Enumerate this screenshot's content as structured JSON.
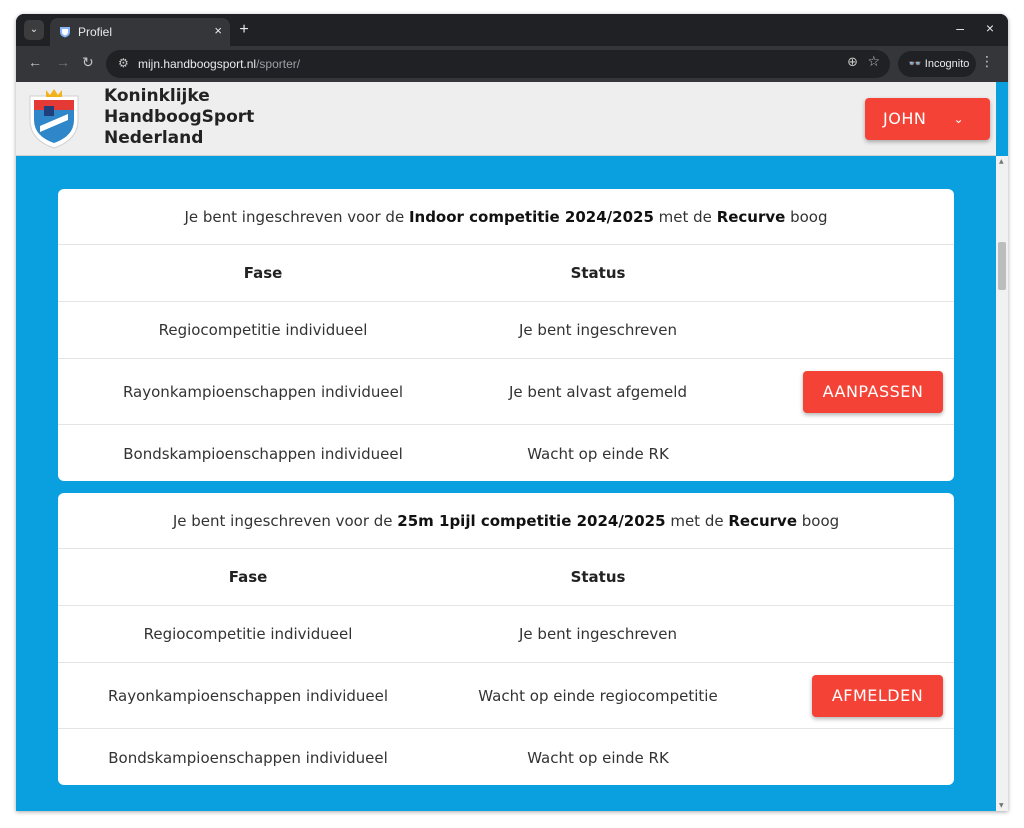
{
  "browser": {
    "tab_title": "Profiel",
    "tab_close": "×",
    "new_tab": "+",
    "url_host": "mijn.handboogsport.nl",
    "url_path": "/sporter/",
    "incognito_label": "Incognito",
    "min": "–",
    "close": "×"
  },
  "header": {
    "org_line1": "Koninklijke",
    "org_line2": "HandboogSport",
    "org_line3": "Nederland",
    "user_button": "JOHN"
  },
  "cards": [
    {
      "intro_prefix": "Je bent ingeschreven voor de ",
      "competition": "Indoor competitie 2024/2025",
      "intro_mid": " met de ",
      "bow": "Recurve",
      "intro_suffix": " boog",
      "col_phase": "Fase",
      "col_status": "Status",
      "rows": [
        {
          "phase": "Regiocompetitie individueel",
          "status": "Je bent ingeschreven"
        },
        {
          "phase": "Rayonkampioenschappen individueel",
          "status": "Je bent alvast afgemeld",
          "action": "AANPASSEN"
        },
        {
          "phase": "Bondskampioenschappen individueel",
          "status": "Wacht op einde RK"
        }
      ]
    },
    {
      "intro_prefix": "Je bent ingeschreven voor de ",
      "competition": "25m 1pijl competitie 2024/2025",
      "intro_mid": " met de ",
      "bow": "Recurve",
      "intro_suffix": " boog",
      "col_phase": "Fase",
      "col_status": "Status",
      "rows": [
        {
          "phase": "Regiocompetitie individueel",
          "status": "Je bent ingeschreven"
        },
        {
          "phase": "Rayonkampioenschappen individueel",
          "status": "Wacht op einde regiocompetitie",
          "action": "AFMELDEN"
        },
        {
          "phase": "Bondskampioenschappen individueel",
          "status": "Wacht op einde RK"
        }
      ]
    }
  ],
  "colors": {
    "page_bg": "#0aa0e0",
    "accent": "#f44336"
  }
}
